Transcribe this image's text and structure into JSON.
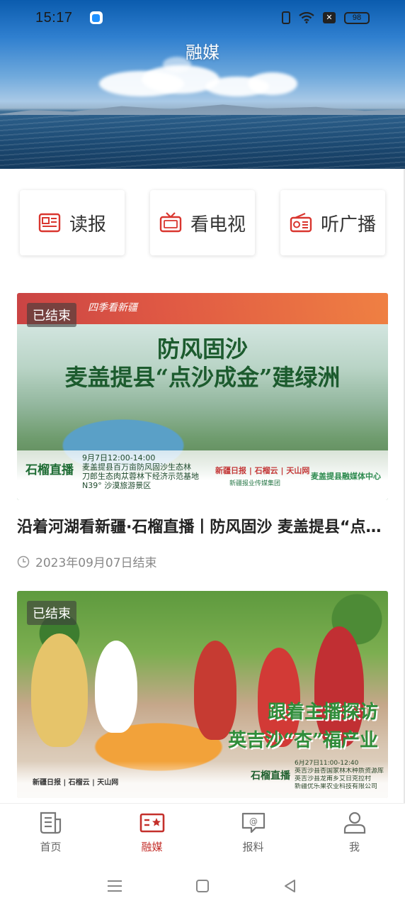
{
  "status_bar": {
    "time": "15:17",
    "battery": "98"
  },
  "header": {
    "title": "融媒"
  },
  "media_buttons": [
    {
      "label": "读报",
      "icon": "newspaper-icon"
    },
    {
      "label": "看电视",
      "icon": "tv-icon"
    },
    {
      "label": "听广播",
      "icon": "radio-icon"
    }
  ],
  "cards": [
    {
      "badge": "已结束",
      "title": "沿着河湖看新疆·石榴直播丨防风固沙 麦盖提县“点沙成金”建绿洲",
      "meta": "2023年09月07日结束",
      "art": {
        "top_tag": "四季看新疆",
        "headline1": "防风固沙",
        "headline2": "麦盖提县“点沙成金”建绿洲",
        "brand": "石榴直播",
        "info": [
          "9月7日12:00-14:00",
          "麦盖提县百万亩防风固沙生态林",
          "刀郎生态肉苁蓉林下经济示范基地",
          "N39° 沙漠旅游景区"
        ],
        "partners": "新疆日报 | 石榴云 | 天山网",
        "group": "新疆报业传媒集团",
        "county": "麦盖提县融媒体中心"
      }
    },
    {
      "badge": "已结束",
      "art": {
        "headline1": "跟着主播探访",
        "headline2": "英吉沙“杏”福产业",
        "brand": "石榴直播",
        "info": [
          "6月27日11:00-12:40",
          "英吉沙县杏国家林木种质资源库",
          "英吉沙县龙甫乡艾日克拉村",
          "新疆优乐果农业科技有限公司"
        ],
        "partners": "新疆日报 | 石榴云 | 天山网"
      }
    }
  ],
  "bottom_nav": [
    {
      "label": "首页",
      "icon": "home-news-icon",
      "active": false
    },
    {
      "label": "融媒",
      "icon": "media-star-icon",
      "active": true
    },
    {
      "label": "报料",
      "icon": "report-chat-icon",
      "active": false
    },
    {
      "label": "我",
      "icon": "profile-icon",
      "active": false
    }
  ],
  "colors": {
    "accent": "#c4302b",
    "inactive": "#666666"
  }
}
